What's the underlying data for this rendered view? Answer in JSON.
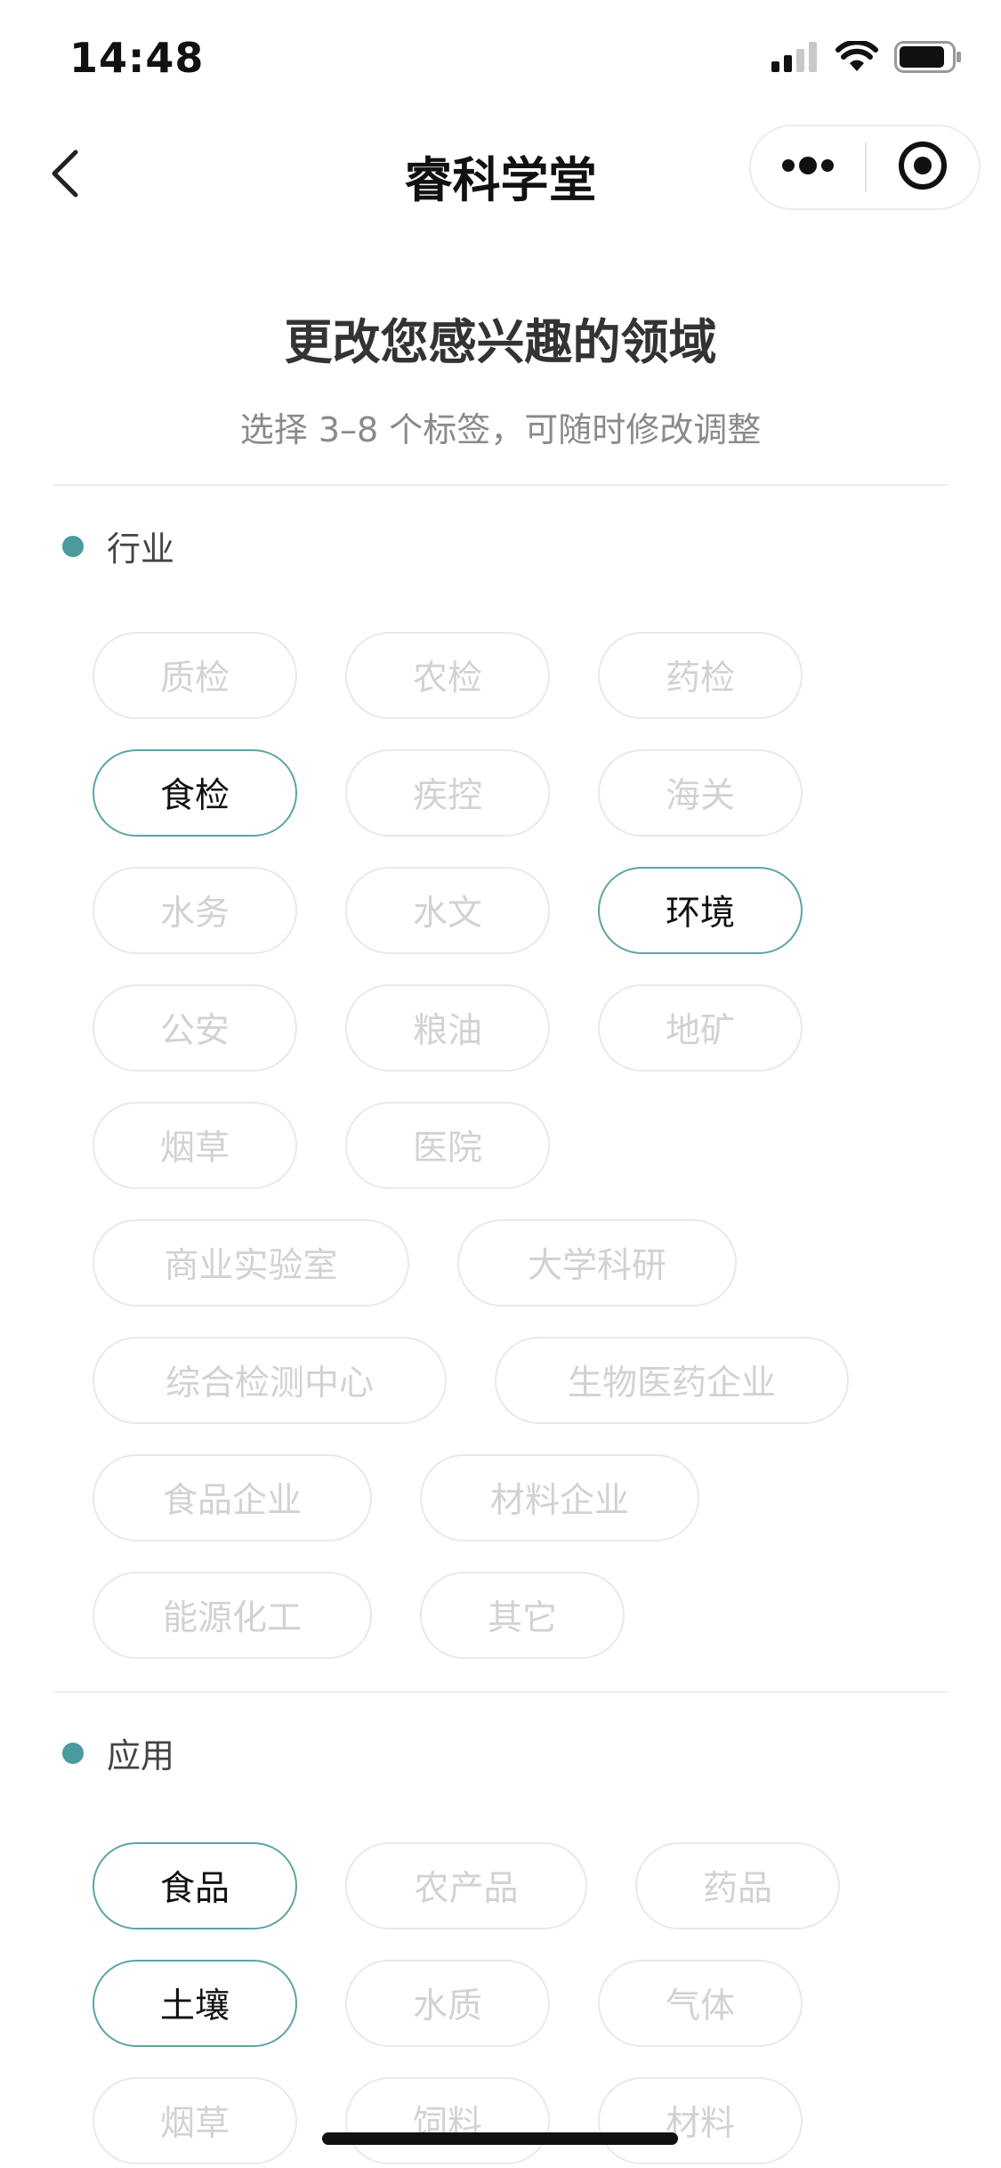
{
  "status_bar": {
    "time": "14:48",
    "icons": [
      "cellular-signal-icon",
      "wifi-icon",
      "battery-icon"
    ]
  },
  "nav": {
    "title": "睿科学堂",
    "back_icon": "chevron-left-icon",
    "more_icon": "more-dots-icon",
    "close_icon": "target-close-icon"
  },
  "header": {
    "title": "更改您感兴趣的领域",
    "subtitle": "选择 3–8 个标签，可随时修改调整"
  },
  "sections": [
    {
      "label": "行业",
      "tags": [
        {
          "label": "质检",
          "selected": false
        },
        {
          "label": "农检",
          "selected": false
        },
        {
          "label": "药检",
          "selected": false
        },
        {
          "label": "食检",
          "selected": true
        },
        {
          "label": "疾控",
          "selected": false
        },
        {
          "label": "海关",
          "selected": false
        },
        {
          "label": "水务",
          "selected": false
        },
        {
          "label": "水文",
          "selected": false
        },
        {
          "label": "环境",
          "selected": true
        },
        {
          "label": "公安",
          "selected": false
        },
        {
          "label": "粮油",
          "selected": false
        },
        {
          "label": "地矿",
          "selected": false
        },
        {
          "label": "烟草",
          "selected": false
        },
        {
          "label": "医院",
          "selected": false
        },
        {
          "label": "商业实验室",
          "selected": false
        },
        {
          "label": "大学科研",
          "selected": false
        },
        {
          "label": "综合检测中心",
          "selected": false
        },
        {
          "label": "生物医药企业",
          "selected": false
        },
        {
          "label": "食品企业",
          "selected": false
        },
        {
          "label": "材料企业",
          "selected": false
        },
        {
          "label": "能源化工",
          "selected": false
        },
        {
          "label": "其它",
          "selected": false
        }
      ]
    },
    {
      "label": "应用",
      "tags": [
        {
          "label": "食品",
          "selected": true
        },
        {
          "label": "农产品",
          "selected": false
        },
        {
          "label": "药品",
          "selected": false
        },
        {
          "label": "土壤",
          "selected": true
        },
        {
          "label": "水质",
          "selected": false
        },
        {
          "label": "气体",
          "selected": false
        },
        {
          "label": "烟草",
          "selected": false
        },
        {
          "label": "饲料",
          "selected": false
        },
        {
          "label": "材料",
          "selected": false
        }
      ]
    }
  ],
  "colors": {
    "accent": "#4a9b9e",
    "selected_border": "#5ba4a5",
    "unselected_text": "#d2d2d2",
    "unselected_border": "#e9e9e9"
  }
}
